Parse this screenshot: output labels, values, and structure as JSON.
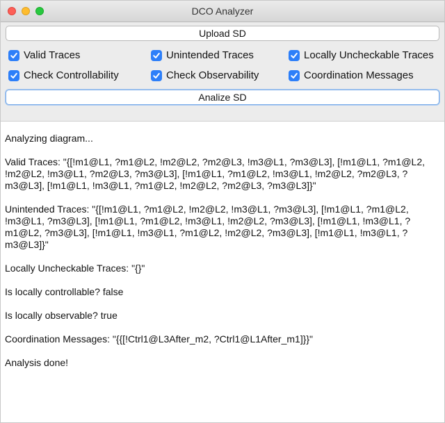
{
  "window": {
    "title": "DCO Analyzer"
  },
  "upload_button": "Upload SD",
  "checkboxes": [
    {
      "label": "Valid Traces",
      "checked": true
    },
    {
      "label": "Unintended Traces",
      "checked": true
    },
    {
      "label": "Locally Uncheckable Traces",
      "checked": true
    },
    {
      "label": "Check Controllability",
      "checked": true
    },
    {
      "label": "Check Observability",
      "checked": true
    },
    {
      "label": "Coordination Messages",
      "checked": true
    }
  ],
  "analyze_button": "Analize SD",
  "output_lines": [
    "Analyzing diagram...",
    "Valid Traces: \"{[!m1@L1, ?m1@L2, !m2@L2, ?m2@L3, !m3@L1, ?m3@L3], [!m1@L1, ?m1@L2, !m2@L2, !m3@L1, ?m2@L3, ?m3@L3], [!m1@L1, ?m1@L2, !m3@L1, !m2@L2, ?m2@L3, ?m3@L3], [!m1@L1, !m3@L1, ?m1@L2, !m2@L2, ?m2@L3, ?m3@L3]}\"",
    "Unintended Traces: \"{[!m1@L1, ?m1@L2, !m2@L2, !m3@L1, ?m3@L3], [!m1@L1, ?m1@L2, !m3@L1, ?m3@L3], [!m1@L1, ?m1@L2, !m3@L1, !m2@L2, ?m3@L3], [!m1@L1, !m3@L1, ?m1@L2, ?m3@L3], [!m1@L1, !m3@L1, ?m1@L2, !m2@L2, ?m3@L3], [!m1@L1, !m3@L1, ?m3@L3]}\"",
    "Locally Uncheckable Traces: \"{}\"",
    "Is locally controllable? false",
    "Is locally observable? true",
    "Coordination Messages: \"{{[!Ctrl1@L3After_m2, ?Ctrl1@L1After_m1]}}\"",
    "Analysis done!"
  ],
  "colors": {
    "checkbox_accent": "#2d7ff9",
    "focus_ring": "#7eaee8"
  }
}
